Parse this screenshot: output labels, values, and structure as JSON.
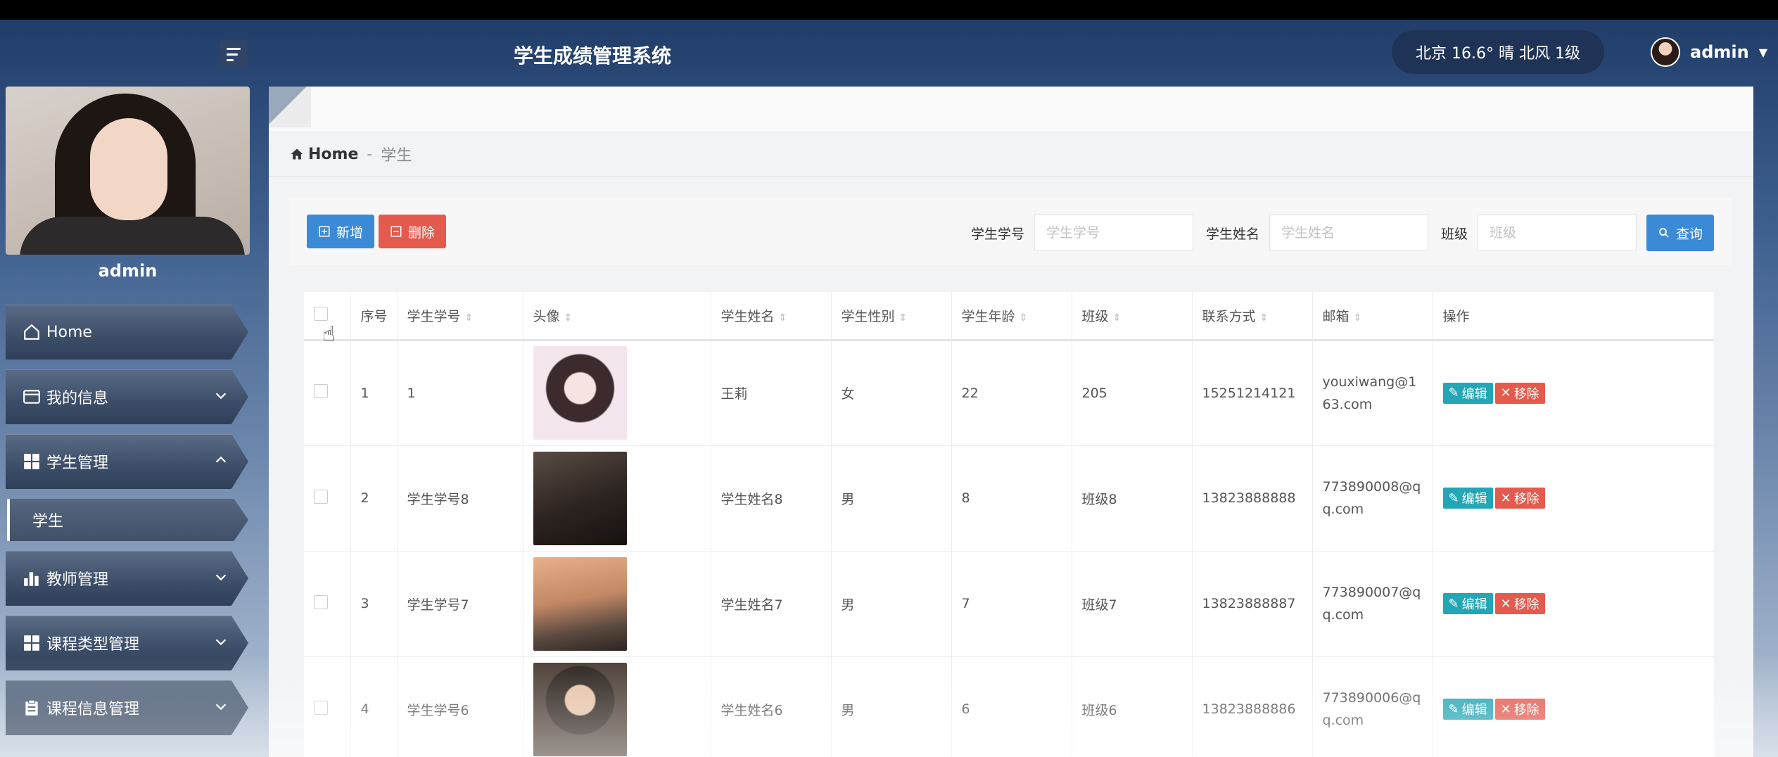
{
  "header": {
    "app_title": "学生成绩管理系统",
    "weather": "北京  16.6°  晴  北风  1级",
    "username": "admin"
  },
  "sidebar": {
    "profile_name": "admin",
    "items": [
      {
        "label": "Home",
        "icon": "home-icon",
        "expanded": null
      },
      {
        "label": "我的信息",
        "icon": "id-card-icon",
        "expanded": false
      },
      {
        "label": "学生管理",
        "icon": "grid-icon",
        "expanded": true
      },
      {
        "label": "教师管理",
        "icon": "bar-chart-icon",
        "expanded": false
      },
      {
        "label": "课程类型管理",
        "icon": "grid-icon",
        "expanded": false
      },
      {
        "label": "课程信息管理",
        "icon": "clipboard-icon",
        "expanded": false
      }
    ],
    "sub_item": "学生"
  },
  "breadcrumb": {
    "home": "Home",
    "separator": "-",
    "current": "学生"
  },
  "toolbar": {
    "add_label": "新增",
    "delete_label": "删除",
    "filters": [
      {
        "label": "学生学号",
        "placeholder": "学生学号"
      },
      {
        "label": "学生姓名",
        "placeholder": "学生姓名"
      },
      {
        "label": "班级",
        "placeholder": "班级"
      }
    ],
    "query_label": "查询"
  },
  "table": {
    "headers": [
      "序号",
      "学生学号",
      "头像",
      "学生姓名",
      "学生性别",
      "学生年龄",
      "班级",
      "联系方式",
      "邮箱",
      "操作"
    ],
    "edit_label": "编辑",
    "remove_label": "移除",
    "rows": [
      {
        "no": "1",
        "sid": "1",
        "name": "王莉",
        "gender": "女",
        "age": "22",
        "class": "205",
        "phone": "15251214121",
        "email": "youxiwang@163.com"
      },
      {
        "no": "2",
        "sid": "学生学号8",
        "name": "学生姓名8",
        "gender": "男",
        "age": "8",
        "class": "班级8",
        "phone": "13823888888",
        "email": "773890008@qq.com"
      },
      {
        "no": "3",
        "sid": "学生学号7",
        "name": "学生姓名7",
        "gender": "男",
        "age": "7",
        "class": "班级7",
        "phone": "13823888887",
        "email": "773890007@qq.com"
      },
      {
        "no": "4",
        "sid": "学生学号6",
        "name": "学生姓名6",
        "gender": "男",
        "age": "6",
        "class": "班级6",
        "phone": "13823888886",
        "email": "773890006@qq.com"
      }
    ]
  },
  "colors": {
    "primary": "#3b8ad6",
    "danger": "#e45a4d",
    "teal": "#23a6b5"
  }
}
